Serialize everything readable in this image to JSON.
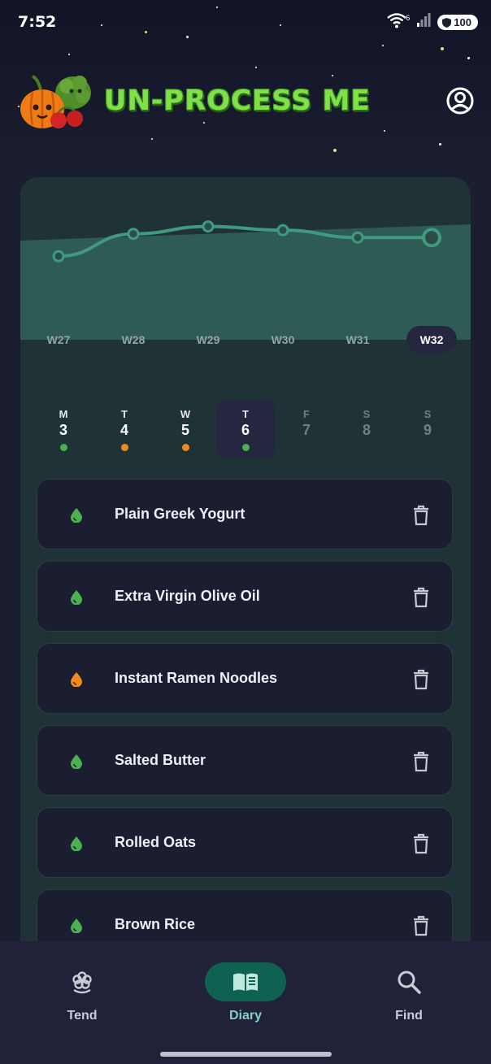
{
  "status_bar": {
    "time": "7:52",
    "wifi_badge": "6",
    "battery": "100"
  },
  "header": {
    "title": "UN-PROCESS ME",
    "logo_icon": "veggie-mascot-logo",
    "profile_icon": "account-circle-icon"
  },
  "chart_data": {
    "type": "line",
    "categories": [
      "W27",
      "W28",
      "W29",
      "W30",
      "W31",
      "W32"
    ],
    "values": [
      1.0,
      2.2,
      2.6,
      2.4,
      2.0,
      2.0
    ],
    "ylim": [
      0,
      3.5
    ],
    "selected": "W32",
    "line_color": "#3f9a7e"
  },
  "weeks": [
    {
      "label": "W27"
    },
    {
      "label": "W28"
    },
    {
      "label": "W29"
    },
    {
      "label": "W30"
    },
    {
      "label": "W31"
    },
    {
      "label": "W32",
      "selected": true
    }
  ],
  "days": [
    {
      "letter": "M",
      "number": "3",
      "status": "green"
    },
    {
      "letter": "T",
      "number": "4",
      "status": "orange"
    },
    {
      "letter": "W",
      "number": "5",
      "status": "orange"
    },
    {
      "letter": "T",
      "number": "6",
      "status": "green",
      "selected": true
    },
    {
      "letter": "F",
      "number": "7",
      "status": "none"
    },
    {
      "letter": "S",
      "number": "8",
      "status": "none"
    },
    {
      "letter": "S",
      "number": "9",
      "status": "none"
    }
  ],
  "foods": [
    {
      "name": "Plain Greek Yogurt",
      "status": "green"
    },
    {
      "name": "Extra Virgin Olive Oil",
      "status": "green"
    },
    {
      "name": "Instant Ramen Noodles",
      "status": "orange"
    },
    {
      "name": "Salted Butter",
      "status": "green"
    },
    {
      "name": "Rolled Oats",
      "status": "green"
    },
    {
      "name": "Brown Rice",
      "status": "green"
    }
  ],
  "colors": {
    "green": "#4caf50",
    "orange": "#f08a1c",
    "accent": "#0f6152"
  },
  "nav": {
    "tend": {
      "label": "Tend",
      "icon": "flower-icon"
    },
    "diary": {
      "label": "Diary",
      "icon": "book-icon"
    },
    "find": {
      "label": "Find",
      "icon": "search-icon"
    }
  }
}
